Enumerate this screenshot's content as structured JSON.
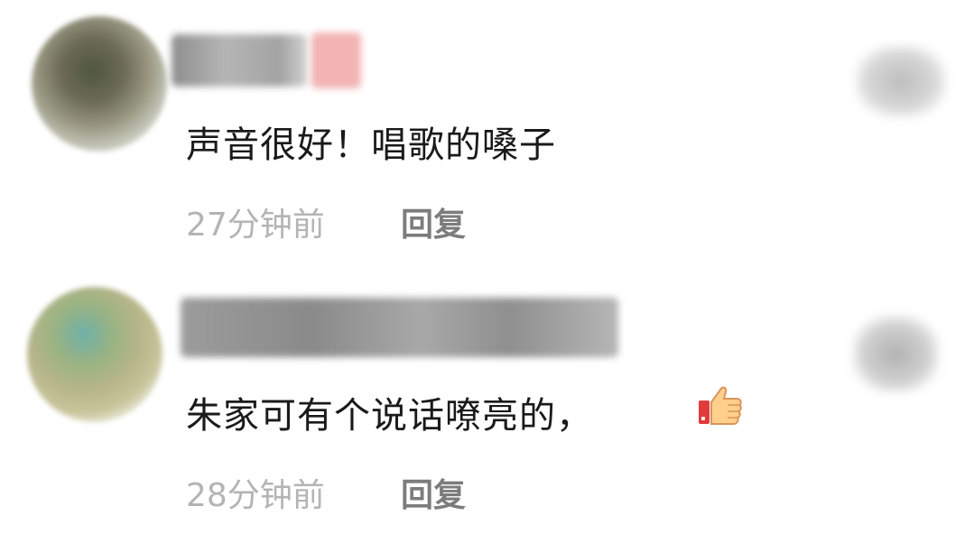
{
  "comments": [
    {
      "text": "声音很好！唱歌的嗓子",
      "time": "27分钟前",
      "reply_label": "回复"
    },
    {
      "text": "朱家可有个说话嘹亮的，",
      "emoji": "thumbs-up-icon",
      "time": "28分钟前",
      "reply_label": "回复"
    }
  ]
}
